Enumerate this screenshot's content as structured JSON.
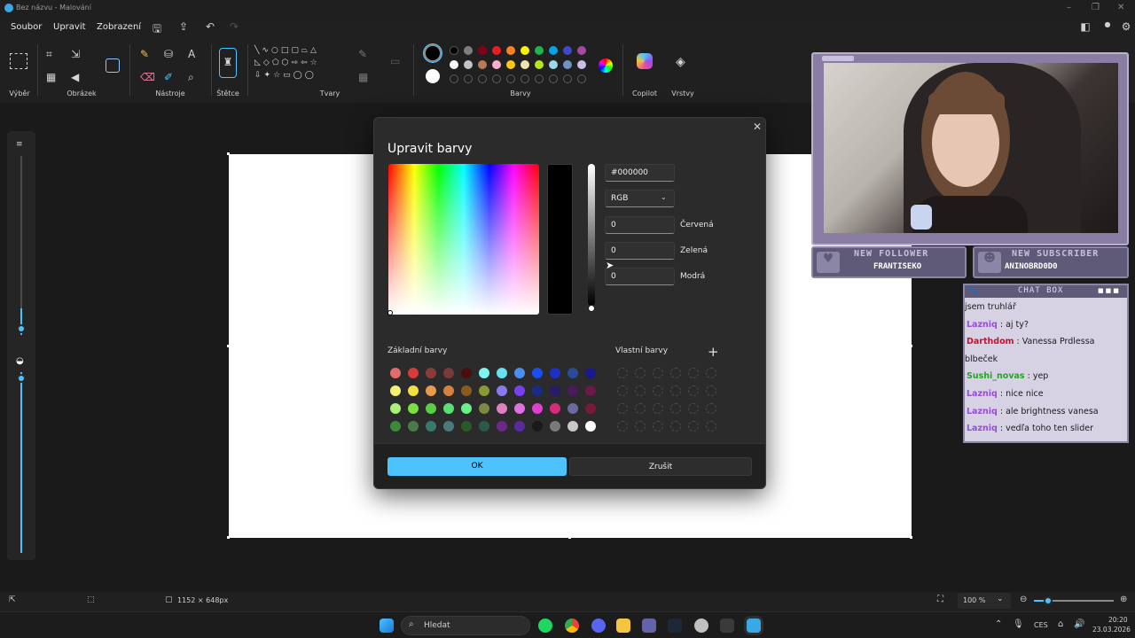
{
  "titlebar": {
    "title": "Bez názvu - Malování"
  },
  "menu": {
    "file": "Soubor",
    "edit": "Upravit",
    "view": "Zobrazení"
  },
  "ribbon": {
    "labels": {
      "selection": "Výběr",
      "image": "Obrázek",
      "tools": "Nástroje",
      "brushes": "Štětce",
      "shapes": "Tvary",
      "colors": "Barvy",
      "copilot": "Copilot",
      "layers": "Vrstvy"
    },
    "palette_row1": [
      "#000000",
      "#7f7f7f",
      "#880015",
      "#ed1c24",
      "#ff7f27",
      "#fff200",
      "#22b14c",
      "#00a2e8",
      "#3f48cc",
      "#a349a4"
    ],
    "palette_row2": [
      "#ffffff",
      "#c3c3c3",
      "#b97a57",
      "#ffaec9",
      "#ffc90e",
      "#efe4b0",
      "#b5e61d",
      "#99d9ea",
      "#7092be",
      "#c8bfe7"
    ]
  },
  "dialog": {
    "title": "Upravit barvy",
    "hex": "#000000",
    "mode": "RGB",
    "red": {
      "value": "0",
      "label": "Červená"
    },
    "green": {
      "value": "0",
      "label": "Zelená"
    },
    "blue": {
      "value": "0",
      "label": "Modrá"
    },
    "basic_label": "Základní barvy",
    "custom_label": "Vlastní barvy",
    "basic_colors": [
      [
        "#e06c6c",
        "#d93a3a",
        "#8c3a3a",
        "#7a3a3a",
        "#4a0e0e",
        "#7ff5f0",
        "#66e0f0",
        "#4a8ff0",
        "#1a4ef0",
        "#1e2fc8",
        "#2a4a9a",
        "#1a1a8c"
      ],
      [
        "#f5f07a",
        "#f0e040",
        "#e89a50",
        "#d88040",
        "#8a5a20",
        "#8a9a30",
        "#8a7af0",
        "#7a40f0",
        "#1a2a8a",
        "#2a1a6a",
        "#4a1a5a",
        "#6a1a4a"
      ],
      [
        "#a8f07a",
        "#7ae040",
        "#5ad040",
        "#5ae070",
        "#6af08a",
        "#7a8a40",
        "#e080c0",
        "#e070e0",
        "#e040d0",
        "#d82a7a",
        "#6a6aa0",
        "#7a1a3a"
      ],
      [
        "#3a8a3a",
        "#4a7a4a",
        "#3a7a6a",
        "#4a7a7a",
        "#2a5a2a",
        "#2a5a4a",
        "#6a2a8a",
        "#5a2aa0",
        "#1a1a1a",
        "#7a7a7a",
        "#c8c8c8",
        "#ffffff"
      ]
    ],
    "ok_label": "OK",
    "cancel_label": "Zrušit"
  },
  "overlay": {
    "follower_title": "NEW FOLLOWER",
    "follower_name": "FRANTISEKO",
    "subscriber_title": "NEW SUBSCRIBER",
    "subscriber_name": "ANINOBRD0D0",
    "chat_title": "CHAT BOX",
    "chat": [
      {
        "user": "",
        "text": "jsem truhlář",
        "color": "#1a1a1a"
      },
      {
        "user": "Lazniq",
        "text": ": aj ty?",
        "color": "#9a4ad8"
      },
      {
        "user": "Darthdom",
        "text": ": Vanessa Prdlessa",
        "color": "#c8102e"
      },
      {
        "user": "",
        "text": "blbeček",
        "color": "#1a1a1a"
      },
      {
        "user": "Sushi_novas",
        "text": ": yep",
        "color": "#2aa02a"
      },
      {
        "user": "Lazniq",
        "text": ": nice nice",
        "color": "#9a4ad8"
      },
      {
        "user": "Lazniq",
        "text": ": ale brightness vanesa",
        "color": "#9a4ad8"
      },
      {
        "user": "Lazniq",
        "text": ": vedľa toho ten slider",
        "color": "#9a4ad8"
      }
    ]
  },
  "status": {
    "canvas_size": "1152 × 648px",
    "zoom": "100 %"
  },
  "taskbar": {
    "search_placeholder": "Hledat",
    "language": "CES",
    "time": "20:20",
    "date": "23.03.2026"
  }
}
